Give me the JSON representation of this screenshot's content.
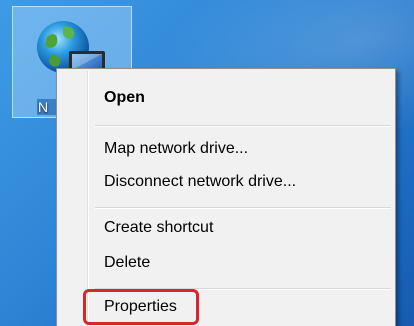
{
  "desktop": {
    "icon": {
      "label": "N",
      "icon_name": "network-globe-icon"
    }
  },
  "context_menu": {
    "items": [
      {
        "label": "Open",
        "bold": true
      },
      {
        "label": "Map network drive..."
      },
      {
        "label": "Disconnect network drive..."
      },
      {
        "label": "Create shortcut"
      },
      {
        "label": "Delete"
      },
      {
        "label": "Properties",
        "highlighted": true
      }
    ]
  },
  "colors": {
    "highlight": "#d9262b",
    "menu_background": "#f1f1f1",
    "desktop_background": "#2f86d6"
  }
}
